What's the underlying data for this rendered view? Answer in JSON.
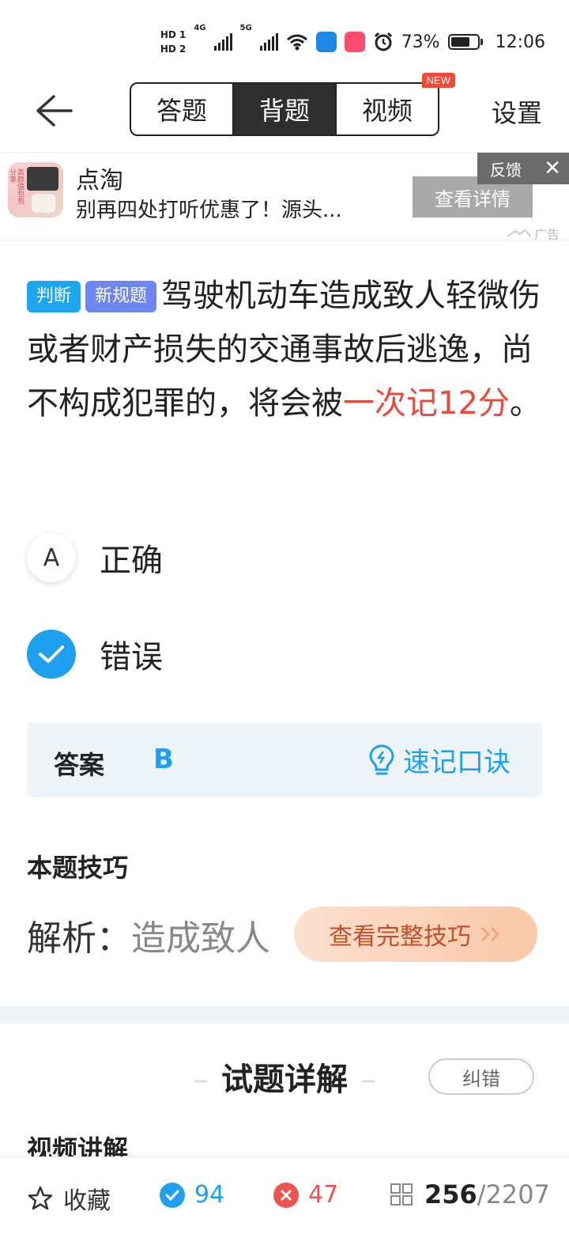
{
  "status_bar": {
    "hd1": "HD 1",
    "hd2": "HD 2",
    "net1": "4G",
    "net2": "5G",
    "battery_percent": "73%",
    "battery_level": 0.73,
    "time": "12:06"
  },
  "nav": {
    "tabs": [
      {
        "label": "答题",
        "active": false
      },
      {
        "label": "背题",
        "active": true
      },
      {
        "label": "视频",
        "active": false
      }
    ],
    "new_badge": "NEW",
    "settings": "设置"
  },
  "ad": {
    "title": "点淘",
    "description": "别再四处打听优惠了！源头...",
    "thumb_text": "高颜值包包分享",
    "feedback": "反馈",
    "close": "✕",
    "detail_button": "查看详情",
    "label": "广告"
  },
  "question": {
    "tags": [
      "判断",
      "新规题"
    ],
    "text_main": "驾驶机动车造成致人轻微伤或者财产损失的交通事故后逃逸，尚不构成犯罪的，将会被",
    "text_highlight": "一次记12分",
    "text_end": "。"
  },
  "options": [
    {
      "key": "A",
      "label": "正确",
      "selected": false
    },
    {
      "key": "B",
      "label": "错误",
      "selected": true
    }
  ],
  "answer": {
    "label": "答案",
    "value": "B",
    "mnemonic": "速记口诀"
  },
  "tips": {
    "title": "本题技巧",
    "analysis_prefix": "解析：",
    "analysis_visible": "造成致人",
    "full_button": "查看完整技巧"
  },
  "detail": {
    "title": "试题详解",
    "report_button": "纠错",
    "video_title": "视频讲解"
  },
  "bottom_bar": {
    "favorite": "收藏",
    "correct_count": "94",
    "wrong_count": "47",
    "current": "256",
    "total": "/2207"
  },
  "colors": {
    "accent_blue": "#1fa0ef",
    "highlight_red": "#e94a3c",
    "tag_purple": "#6d86f0",
    "badge_red": "#f04a3a"
  }
}
